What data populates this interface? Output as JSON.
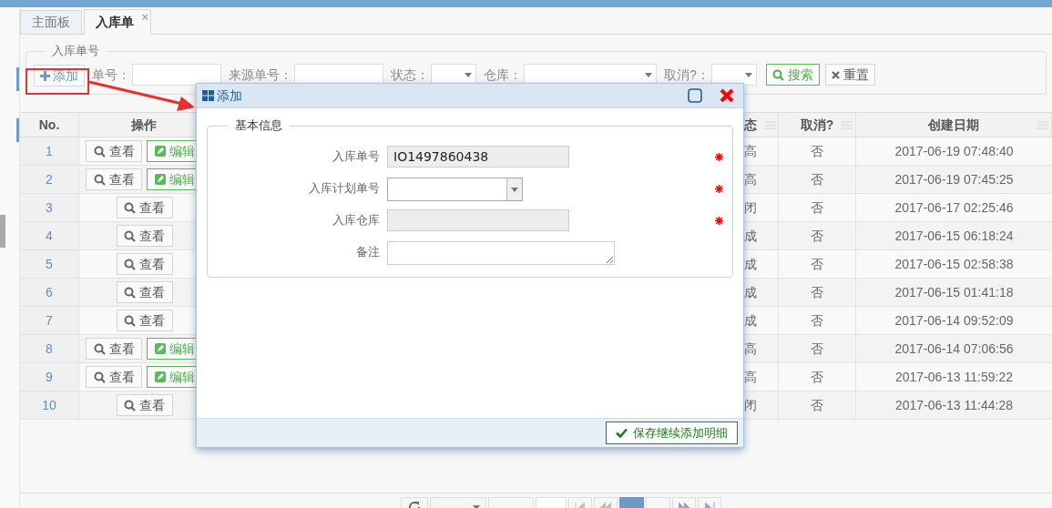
{
  "tabs": [
    {
      "label": "主面板",
      "selected": false
    },
    {
      "label": "入库单",
      "selected": true,
      "close": "×"
    }
  ],
  "filter": {
    "legend": "入库单号",
    "add_button": "添加",
    "fields": [
      {
        "kind": "input",
        "label": "单号："
      },
      {
        "kind": "input",
        "label": "来源单号："
      },
      {
        "kind": "select",
        "label": "状态："
      },
      {
        "kind": "select",
        "label": "仓库："
      },
      {
        "kind": "select",
        "label": "取消?："
      }
    ],
    "search_button": "搜索",
    "reset_button": "重置"
  },
  "table": {
    "columns": [
      "No.",
      "操作",
      "态",
      "取消?",
      "创建日期"
    ],
    "rows": [
      {
        "no": "1",
        "actions": [
          {
            "kind": "view",
            "label": "查看"
          },
          {
            "kind": "edit",
            "label": "编辑"
          }
        ],
        "status": "高",
        "cancelled": "否",
        "created": "2017-06-19 07:48:40"
      },
      {
        "no": "2",
        "actions": [
          {
            "kind": "view",
            "label": "查看"
          },
          {
            "kind": "edit",
            "label": "编辑"
          }
        ],
        "status": "高",
        "cancelled": "否",
        "created": "2017-06-19 07:45:25"
      },
      {
        "no": "3",
        "actions": [
          {
            "kind": "view",
            "label": "查看"
          }
        ],
        "status": "闭",
        "cancelled": "否",
        "created": "2017-06-17 02:25:46"
      },
      {
        "no": "4",
        "actions": [
          {
            "kind": "view",
            "label": "查看"
          }
        ],
        "status": "成",
        "cancelled": "否",
        "created": "2017-06-15 06:18:24"
      },
      {
        "no": "5",
        "actions": [
          {
            "kind": "view",
            "label": "查看"
          }
        ],
        "status": "成",
        "cancelled": "否",
        "created": "2017-06-15 02:58:38"
      },
      {
        "no": "6",
        "actions": [
          {
            "kind": "view",
            "label": "查看"
          }
        ],
        "status": "成",
        "cancelled": "否",
        "created": "2017-06-15 01:41:18"
      },
      {
        "no": "7",
        "actions": [
          {
            "kind": "view",
            "label": "查看"
          }
        ],
        "status": "成",
        "cancelled": "否",
        "created": "2017-06-14 09:52:09"
      },
      {
        "no": "8",
        "actions": [
          {
            "kind": "view",
            "label": "查看"
          },
          {
            "kind": "edit",
            "label": "编辑"
          }
        ],
        "status": "高",
        "cancelled": "否",
        "created": "2017-06-14 07:06:56"
      },
      {
        "no": "9",
        "actions": [
          {
            "kind": "view",
            "label": "查看"
          },
          {
            "kind": "edit",
            "label": "编辑"
          }
        ],
        "status": "高",
        "cancelled": "否",
        "created": "2017-06-13 11:59:22"
      },
      {
        "no": "10",
        "actions": [
          {
            "kind": "view",
            "label": "查看"
          }
        ],
        "status": "闭",
        "cancelled": "否",
        "created": "2017-06-13 11:44:28"
      }
    ]
  },
  "pagination": {
    "pages": [
      {
        "selected": true
      },
      {
        "selected": false
      }
    ]
  },
  "dialog": {
    "title": "添加",
    "legend": "基本信息",
    "fields": [
      {
        "label": "入库单号",
        "kind": "text",
        "value": "IO1497860438",
        "disabled": true,
        "required": true
      },
      {
        "label": "入库计划单号",
        "kind": "select",
        "disabled": false,
        "required": true
      },
      {
        "label": "入库仓库",
        "kind": "text",
        "disabled": true,
        "required": true
      },
      {
        "label": "备注",
        "kind": "textarea",
        "disabled": false,
        "required": false
      }
    ],
    "save_button": "保存继续添加明细"
  }
}
